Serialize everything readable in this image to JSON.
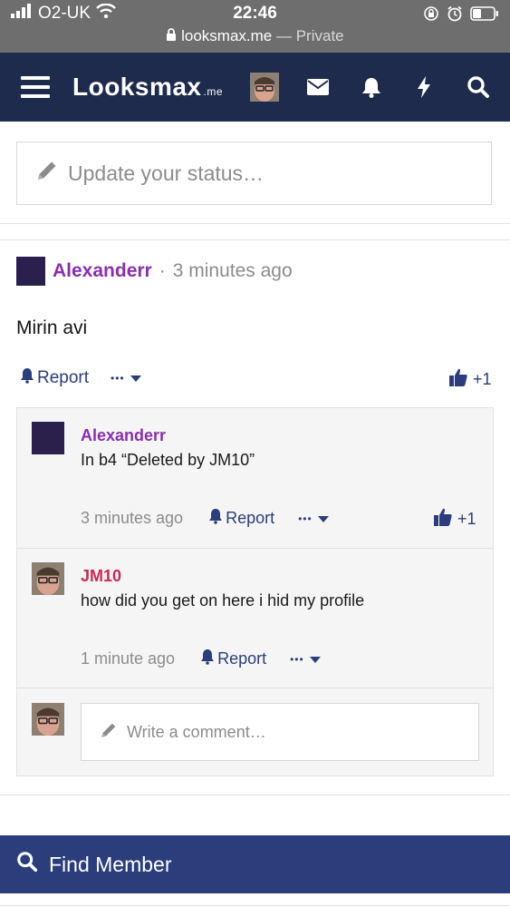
{
  "status_bar": {
    "carrier": "O2-UK",
    "time": "22:46",
    "url": "looksmax.me",
    "private_label": "— Private"
  },
  "navbar": {
    "logo_text": "Looksmax",
    "logo_suffix": ".me",
    "icons": [
      "menu-icon",
      "avatar",
      "envelope-icon",
      "bell-icon",
      "bolt-icon",
      "search-icon"
    ]
  },
  "status_update": {
    "placeholder": "Update your status…"
  },
  "post": {
    "author": "Alexanderr",
    "separator": "·",
    "time": "3 minutes ago",
    "text": "Mirin avi",
    "report_label": "Report",
    "more_label": "•••",
    "likes": "+1"
  },
  "comments": [
    {
      "author": "Alexanderr",
      "text": "In b4 “Deleted by JM10”",
      "time": "3 minutes ago",
      "report_label": "Report",
      "more_label": "•••",
      "likes": "+1"
    },
    {
      "author": "JM10",
      "text": "how did you get on here i hid my profile",
      "time": "1 minute ago",
      "report_label": "Report",
      "more_label": "•••"
    }
  ],
  "comment_input": {
    "placeholder": "Write a comment…"
  },
  "footer": {
    "find_member_label": "Find Member"
  },
  "colors": {
    "navbar": "#1f2b4d",
    "accent": "#2b3d7a",
    "name_purple": "#8a2fb0",
    "name_pink": "#cc2a55"
  }
}
